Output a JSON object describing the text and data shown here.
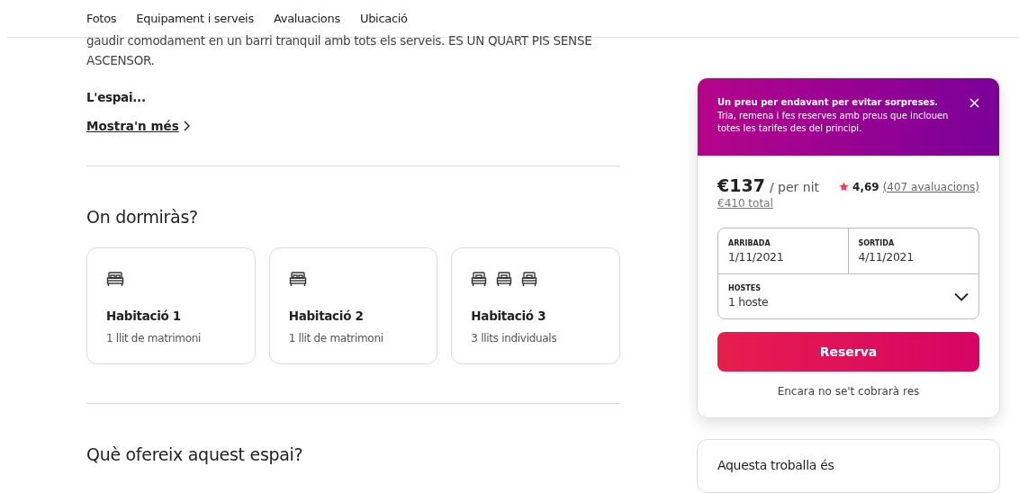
{
  "nav": {
    "links": [
      "Fotos",
      "Equipament i serveis",
      "Avaluacions",
      "Ubicació"
    ]
  },
  "description": {
    "lines": [
      "gaudir comodament en un barri tranquil amb tots els serveis. ES UN QUART PIS SENSE",
      "ASCENSOR."
    ],
    "subheading": "L'espai...",
    "more_link": "Mostra'n més"
  },
  "sleeping": {
    "title": "On dormiràs?",
    "rooms": [
      {
        "name": "Habitació 1",
        "beds_text": "1 llit de matrimoni",
        "beds": [
          {
            "kind": "double"
          }
        ]
      },
      {
        "name": "Habitació 2",
        "beds_text": "1 llit de matrimoni",
        "beds": [
          {
            "kind": "double"
          }
        ]
      },
      {
        "name": "Habitació 3",
        "beds_text": "3 llits individuals",
        "beds": [
          {
            "kind": "single"
          },
          {
            "kind": "single"
          },
          {
            "kind": "single"
          }
        ]
      }
    ]
  },
  "amenities": {
    "title": "Què ofereix aquest espai?"
  },
  "booking": {
    "banner": {
      "bold": "Un preu per endavant per evitar sorpreses.",
      "text": "Tria, remena i fes reserves amb preus que inclouen totes les tarifes des del principi."
    },
    "price": "€137",
    "per": "/ per nit",
    "total": "€410 total",
    "rating": "4,69",
    "reviews": "(407 avaluacions)",
    "checkin": {
      "label": "ARRIBADA",
      "value": "1/11/2021"
    },
    "checkout": {
      "label": "SORTIDA",
      "value": "4/11/2021"
    },
    "guests": {
      "label": "HOSTES",
      "value": "1 hoste"
    },
    "button": "Reserva",
    "note": "Encara no se't cobrarà res"
  },
  "deal": {
    "title": "Aquesta troballa és"
  }
}
